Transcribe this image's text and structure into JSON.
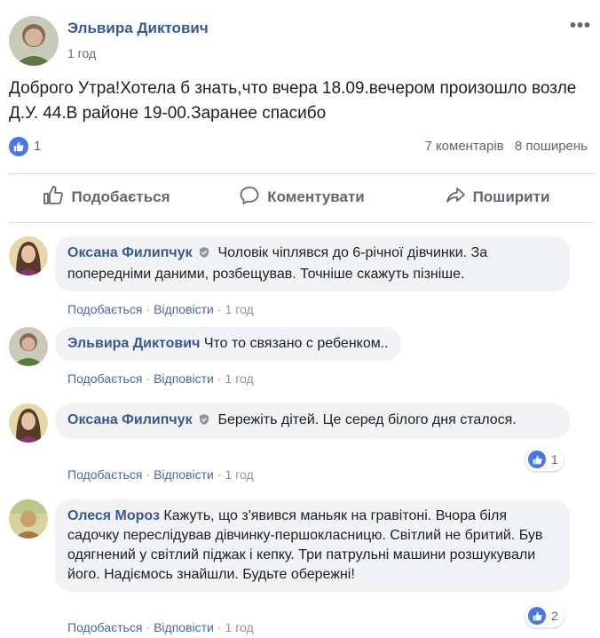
{
  "post": {
    "author": "Эльвира Диктович",
    "time": "1 год",
    "more": "•••",
    "text": "Доброго Утра!Хотела б знать,что вчера 18.09.вечером произошло возле Д.У. 44.В районе 19-00.Заранее спасибо",
    "like_count": "1",
    "comments_count": "7 коментарів",
    "shares_count": "8 поширень"
  },
  "actions": {
    "like": "Подобається",
    "comment": "Коментувати",
    "share": "Поширити"
  },
  "comment_meta": {
    "like": "Подобається",
    "reply": "Відповісти",
    "sep": "·"
  },
  "comments": [
    {
      "author": "Оксана Филипчук",
      "text": "Чоловік чіплявся до 6-річної дівчинки. За попередніми даними, розбещував. Точніше скажуть пізніше.",
      "time": "1 год",
      "reactions": ""
    },
    {
      "author": "Эльвира Диктович",
      "text": "Что то связано с ребенком..",
      "time": "1 год",
      "reactions": ""
    },
    {
      "author": "Оксана Филипчук",
      "text": "Бережіть дітей. Це серед білого дня сталося.",
      "time": "1 год",
      "reactions": "1"
    },
    {
      "author": "Олеся Мороз",
      "text": "Кажуть, що з'явився маньяк на гравітоні. Вчора біля садочку переслідував дівчинку-першокласницю. Світлий не бритий. Був одягнений у світлий піджак і кепку. Три патрульні машини розшукували його. Надіємось знайшли. Будьте обережні!",
      "time": "1 год",
      "reactions": "2"
    }
  ],
  "colors": {
    "link": "#385898",
    "like_blue": "#4a76e8",
    "bubble": "#f2f3f5",
    "muted": "#606770"
  },
  "icons": {
    "like": "thumbs-up-icon",
    "comment": "speech-bubble-icon",
    "share": "share-arrow-icon",
    "verified": "shield-icon",
    "more": "more-dots-icon"
  }
}
